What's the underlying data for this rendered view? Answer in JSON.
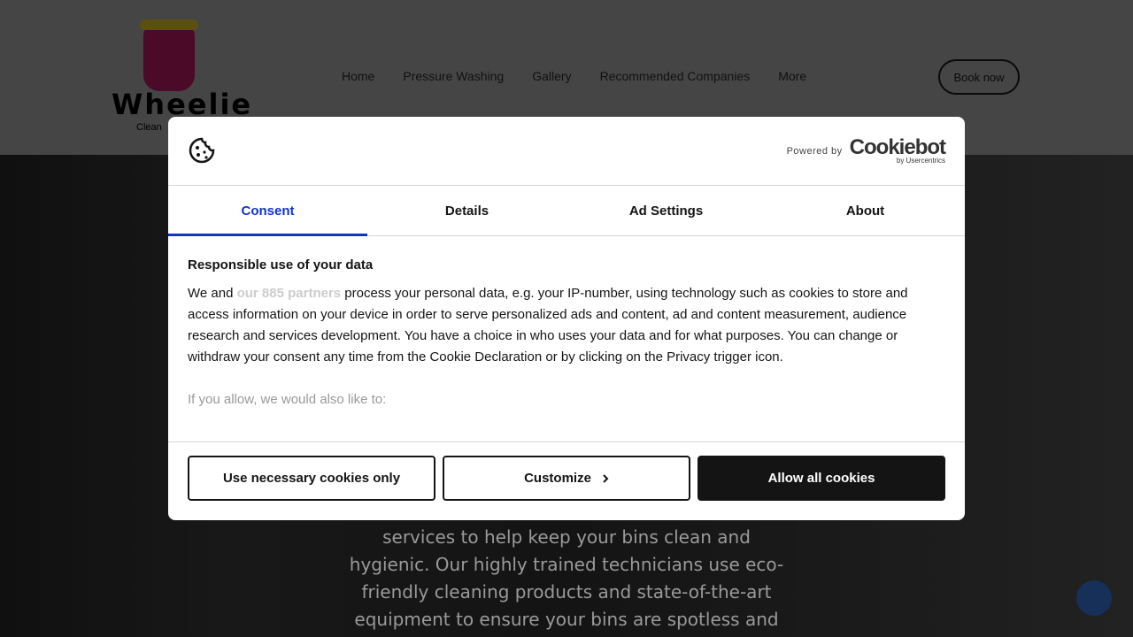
{
  "site": {
    "logo_text": "Wheelie",
    "logo_sub": "Clean",
    "nav": [
      "Home",
      "Pressure Washing",
      "Gallery",
      "Recommended Companies",
      "More"
    ],
    "book": "Book now"
  },
  "hero": {
    "text": "services to help keep your bins clean and hygienic. Our highly trained technicians use eco-friendly cleaning products and state-of-the-art equipment to ensure your bins are spotless and"
  },
  "dialog": {
    "powered_by": "Powered by",
    "brand": "Cookiebot",
    "brand_sub": "by Usercentrics",
    "tabs": [
      "Consent",
      "Details",
      "Ad Settings",
      "About"
    ],
    "heading": "Responsible use of your data",
    "p1_pre": "We and ",
    "p1_link": "our 885 partners",
    "p1_post": " process your personal data, e.g. your IP-number, using technology such as cookies to store and access information on your device in order to serve personalized ads and content, ad and content measurement, audience research and services development. You have a choice in who uses your data and for what purposes. You can change or withdraw your consent any time from the Cookie Declaration or by clicking on the Privacy trigger icon.",
    "p2": "If you allow, we would also like to:",
    "buttons": {
      "necessary": "Use necessary cookies only",
      "customize": "Customize",
      "allow": "Allow all cookies"
    }
  },
  "colors": {
    "accent": "#1032cf",
    "dark_button": "#141414"
  }
}
